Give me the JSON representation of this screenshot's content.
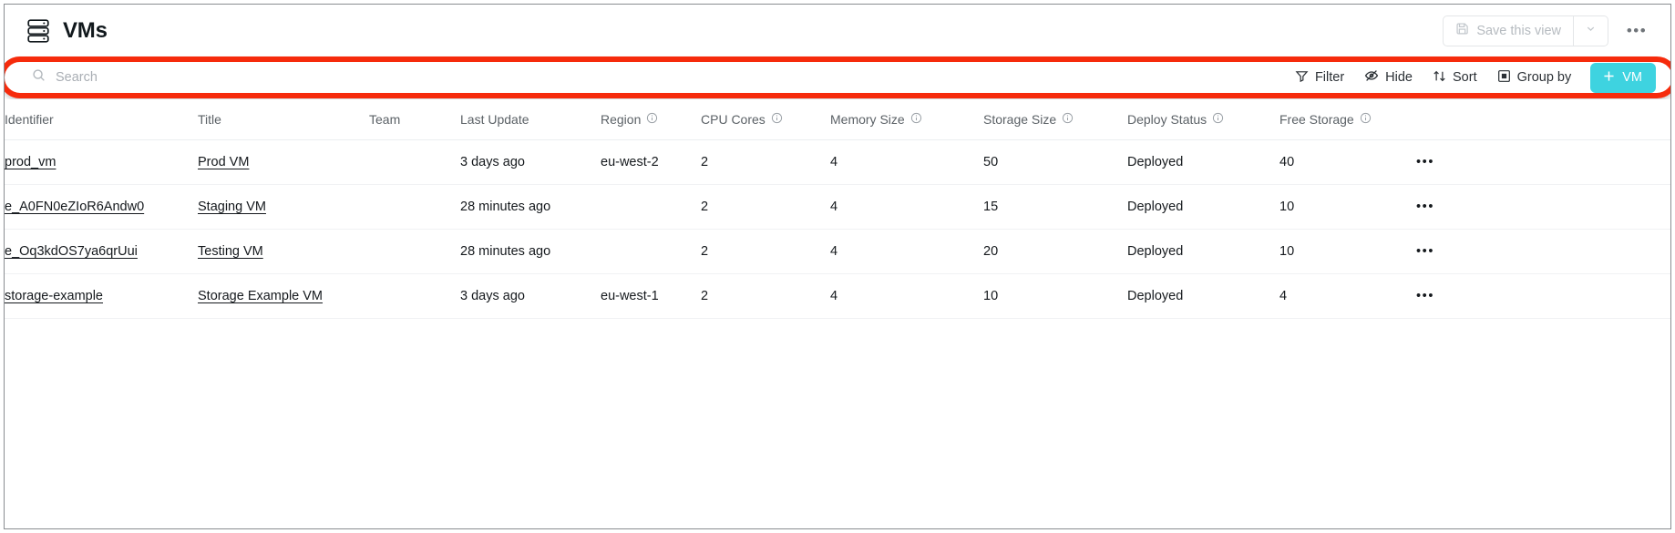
{
  "header": {
    "title": "VMs",
    "icon": "server-stack-icon",
    "save_view_label": "Save this view",
    "save_view_caret_icon": "chevron-down-icon",
    "overflow_icon": "ellipsis-icon",
    "overflow_label": "•••"
  },
  "toolbar": {
    "search_placeholder": "Search",
    "search_value": "",
    "search_icon": "search-icon",
    "actions": [
      {
        "label": "Filter",
        "icon": "filter-icon"
      },
      {
        "label": "Hide",
        "icon": "eye-off-icon"
      },
      {
        "label": "Sort",
        "icon": "sort-arrows-icon"
      },
      {
        "label": "Group by",
        "icon": "group-by-icon"
      }
    ],
    "add_button": {
      "label": "VM",
      "icon": "plus-icon"
    },
    "highlight_color": "#f62b0c",
    "accent_color": "#3ed3e0"
  },
  "table": {
    "columns": [
      {
        "label": "Identifier",
        "info": false
      },
      {
        "label": "Title",
        "info": false
      },
      {
        "label": "Team",
        "info": false
      },
      {
        "label": "Last Update",
        "info": false
      },
      {
        "label": "Region",
        "info": true
      },
      {
        "label": "CPU Cores",
        "info": true
      },
      {
        "label": "Memory Size",
        "info": true
      },
      {
        "label": "Storage Size",
        "info": true
      },
      {
        "label": "Deploy Status",
        "info": true
      },
      {
        "label": "Free Storage",
        "info": true
      }
    ],
    "rows": [
      {
        "identifier": "prod_vm",
        "title": "Prod VM",
        "team": "",
        "last_update": "3 days ago",
        "region": "eu-west-2",
        "cpu_cores": "2",
        "memory_size": "4",
        "storage_size": "50",
        "deploy_status": "Deployed",
        "free_storage": "40",
        "menu": "•••"
      },
      {
        "identifier": "e_A0FN0eZIoR6Andw0",
        "title": "Staging VM",
        "team": "",
        "last_update": "28 minutes ago",
        "region": "",
        "cpu_cores": "2",
        "memory_size": "4",
        "storage_size": "15",
        "deploy_status": "Deployed",
        "free_storage": "10",
        "menu": "•••"
      },
      {
        "identifier": "e_Oq3kdOS7ya6qrUui",
        "title": "Testing VM",
        "team": "",
        "last_update": "28 minutes ago",
        "region": "",
        "cpu_cores": "2",
        "memory_size": "4",
        "storage_size": "20",
        "deploy_status": "Deployed",
        "free_storage": "10",
        "menu": "•••"
      },
      {
        "identifier": "storage-example",
        "title": "Storage Example VM",
        "team": "",
        "last_update": "3 days ago",
        "region": "eu-west-1",
        "cpu_cores": "2",
        "memory_size": "4",
        "storage_size": "10",
        "deploy_status": "Deployed",
        "free_storage": "4",
        "menu": "•••"
      }
    ]
  }
}
